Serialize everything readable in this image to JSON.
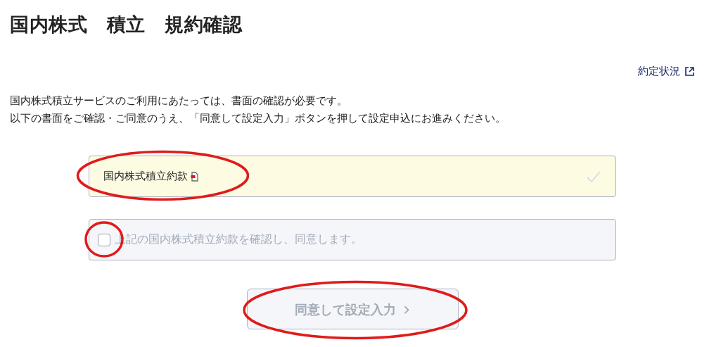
{
  "page_title": "国内株式　積立　規約確認",
  "status_link": {
    "label": "約定状況"
  },
  "intro": [
    "国内株式積立サービスのご利用にあたっては、書面の確認が必要です。",
    "以下の書面をご確認・ご同意のうえ、「同意して設定入力」ボタンを押して設定申込にお進みください。"
  ],
  "document": {
    "label": "国内株式積立約款",
    "confirmed": false,
    "circled": true
  },
  "agreement": {
    "label": "上記の国内株式積立約款を確認し、同意します。",
    "checked": false,
    "disabled": true,
    "circled": true
  },
  "submit_button": {
    "label": "同意して設定入力",
    "icon": "›",
    "disabled": true,
    "circled": true
  }
}
